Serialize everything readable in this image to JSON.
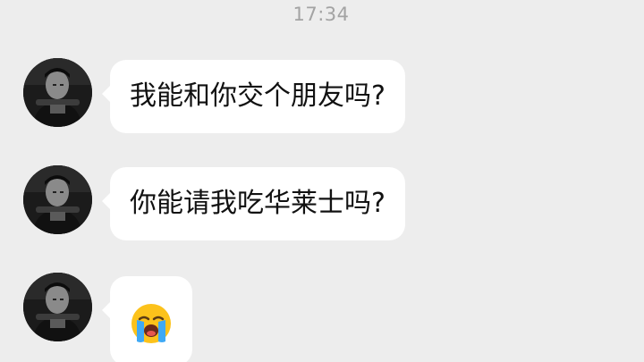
{
  "chat": {
    "timestamp": "17:34",
    "messages": [
      {
        "sender": "incoming",
        "text": "我能和你交个朋友吗?"
      },
      {
        "sender": "incoming",
        "text": "你能请我吃华莱士吗?"
      },
      {
        "sender": "incoming",
        "emoji": "loudly-crying-face"
      }
    ]
  },
  "colors": {
    "background": "#ededed",
    "bubble": "#ffffff",
    "timestamp": "#a3a3a3",
    "text": "#111111",
    "emoji_face": "#fcc21b",
    "emoji_tears": "#3fa9f5"
  }
}
